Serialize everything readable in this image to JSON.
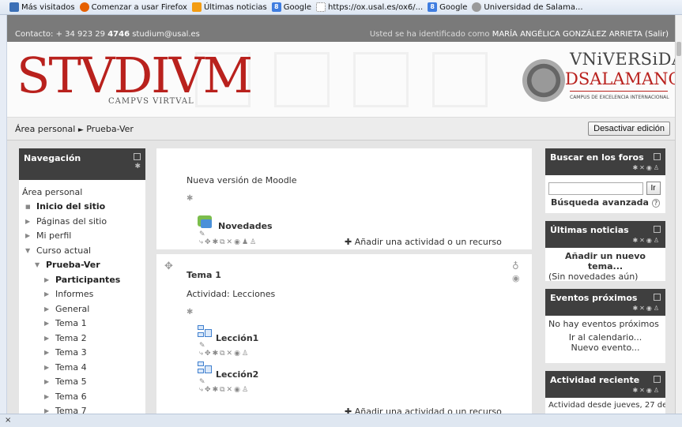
{
  "bookmarks": [
    {
      "label": "Más visitados",
      "icon": "star-folder-icon"
    },
    {
      "label": "Comenzar a usar Firefox",
      "icon": "firefox-icon"
    },
    {
      "label": "Últimas noticias",
      "icon": "rss-icon"
    },
    {
      "label": "Google",
      "icon": "google-icon"
    },
    {
      "label": "https://ox.usal.es/ox6/...",
      "icon": "page-icon"
    },
    {
      "label": "Google",
      "icon": "google-icon"
    },
    {
      "label": "Universidad de Salama...",
      "icon": "university-icon"
    }
  ],
  "contact": {
    "prefix": "Contacto: + 34 923 29 ",
    "ext": "4746",
    "email": " studium@usal.es",
    "user_prefix": "Usted se ha identificado como ",
    "user_name": "MARÍA ANGÉLICA GONZÁLEZ ARRIETA",
    "logout": " (Salir)"
  },
  "header": {
    "logo": "STVDIVM",
    "logo_sub": "CAMPVS VIRTVAL",
    "univ_line1": "VNiVERSiDAD",
    "univ_line2": "DSALAMANCA",
    "univ_line3": "CAMPUS DE EXCELENCIA INTERNACIONAL"
  },
  "breadcrumb": {
    "home": "Área personal",
    "separator": "►",
    "current": "Prueba-Ver"
  },
  "edit_button": "Desactivar edición",
  "navigation": {
    "title": "Navegación",
    "items": [
      {
        "label": "Área personal",
        "marker": "",
        "indent": 0,
        "bold": false
      },
      {
        "label": "Inicio del sitio",
        "marker": "■",
        "indent": 1,
        "bold": true
      },
      {
        "label": "Páginas del sitio",
        "marker": "▶",
        "indent": 1,
        "bold": false
      },
      {
        "label": "Mi perfil",
        "marker": "▶",
        "indent": 1,
        "bold": false
      },
      {
        "label": "Curso actual",
        "marker": "▼",
        "indent": 1,
        "bold": false
      },
      {
        "label": "Prueba-Ver",
        "marker": "▼",
        "indent": 2,
        "bold": true
      },
      {
        "label": "Participantes",
        "marker": "▶",
        "indent": 3,
        "bold": true
      },
      {
        "label": "Informes",
        "marker": "▶",
        "indent": 3,
        "bold": false
      },
      {
        "label": "General",
        "marker": "▶",
        "indent": 3,
        "bold": false
      },
      {
        "label": "Tema 1",
        "marker": "▶",
        "indent": 3,
        "bold": false
      },
      {
        "label": "Tema 2",
        "marker": "▶",
        "indent": 3,
        "bold": false
      },
      {
        "label": "Tema 3",
        "marker": "▶",
        "indent": 3,
        "bold": false
      },
      {
        "label": "Tema 4",
        "marker": "▶",
        "indent": 3,
        "bold": false
      },
      {
        "label": "Tema 5",
        "marker": "▶",
        "indent": 3,
        "bold": false
      },
      {
        "label": "Tema 6",
        "marker": "▶",
        "indent": 3,
        "bold": false
      },
      {
        "label": "Tema 7",
        "marker": "▶",
        "indent": 3,
        "bold": false
      }
    ]
  },
  "section0": {
    "summary": "Nueva versión de Moodle",
    "forum_label": "Novedades",
    "add_activity": "Añadir una actividad o un recurso"
  },
  "section1": {
    "title": "Tema 1",
    "summary": "Actividad: Lecciones",
    "lesson1": "Lección1",
    "lesson2": "Lección2",
    "add_activity": "Añadir una actividad o un recurso"
  },
  "blocks": {
    "search": {
      "title": "Buscar en los foros",
      "button": "Ir",
      "advanced": "Búsqueda avanzada"
    },
    "news": {
      "title": "Últimas noticias",
      "add": "Añadir un nuevo tema...",
      "none": "(Sin novedades aún)"
    },
    "events": {
      "title": "Eventos próximos",
      "none": "No hay eventos próximos",
      "calendar": "Ir al calendario...",
      "new_event": "Nuevo evento..."
    },
    "recent": {
      "title": "Actividad reciente",
      "since": "Actividad desde jueves, 27 de"
    }
  },
  "findbar": {
    "close": "×"
  }
}
